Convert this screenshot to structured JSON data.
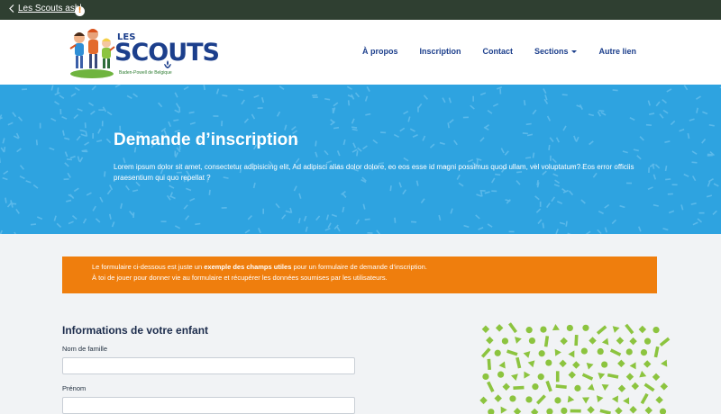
{
  "topbar": {
    "back_label": "Les Scouts asbl",
    "back_icon": "chevron-left-icon"
  },
  "logo": {
    "les": "LES",
    "scouts": "SCOUTS",
    "subtitle": "Baden-Powell de Belgique"
  },
  "nav": {
    "items": [
      {
        "label": "À propos"
      },
      {
        "label": "Inscription"
      },
      {
        "label": "Contact"
      },
      {
        "label": "Sections",
        "dropdown": true
      },
      {
        "label": "Autre lien"
      }
    ]
  },
  "hero": {
    "title": "Demande d’inscription",
    "text": "Lorem ipsum dolor sit amet, consectetur adipisicing elit, Ad adipisci alias dolor dolore, eo eos esse id magni possimus quod ullam, vel voluptatum? Eos error officiis praesentium qui quo repellat ?"
  },
  "alert": {
    "icon": "exclamation-icon",
    "line1_before": "Le formulaire ci-dessous est juste un ",
    "line1_bold": "exemple des champs utiles",
    "line1_after": " pour un formulaire de demande d’inscription.",
    "line2": "À toi de jouer pour donner vie au formulaire et récupérer les données soumises par les utilisateurs."
  },
  "form": {
    "title": "Informations de votre enfant",
    "fields": [
      {
        "label": "Nom de famille",
        "value": "",
        "placeholder": ""
      },
      {
        "label": "Prénom",
        "value": "",
        "placeholder": ""
      }
    ]
  },
  "colors": {
    "topbar": "#2f3f31",
    "brand_blue": "#1c3f8c",
    "hero": "#2ea3e0",
    "alert": "#ef7e0d",
    "confetti": "#8cc43f"
  }
}
